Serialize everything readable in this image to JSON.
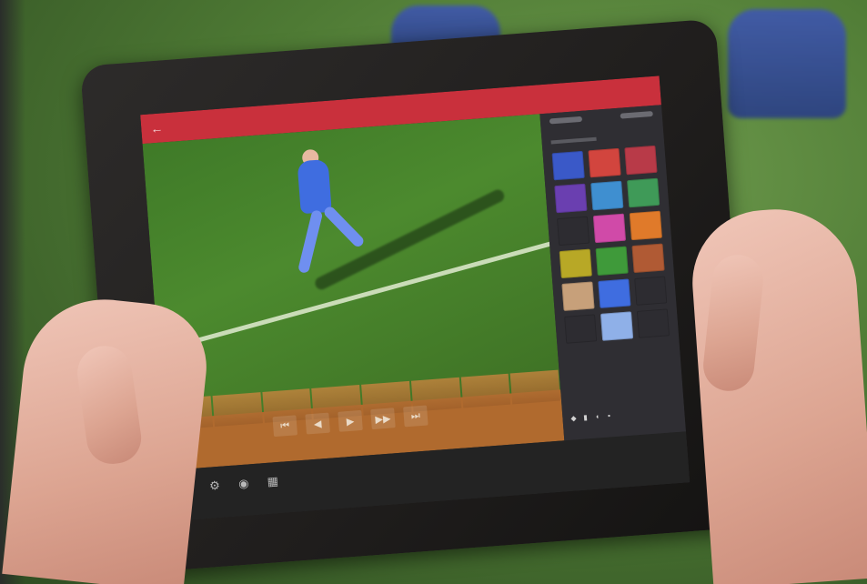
{
  "scene": {
    "background": "green football pitch with blurred players in blue kits",
    "colors": {
      "app_bar": "#c9303c",
      "panel": "#2f2e33",
      "pitch": "#4c8a2e",
      "timeline": "#b06a2e",
      "bezel": "#1f1d1c"
    }
  },
  "tablet": {
    "app_bar": {
      "back_icon": "back-arrow-icon",
      "title": ""
    },
    "video": {
      "content": "football player in blue kit running on pitch"
    },
    "timeline": {
      "controls": [
        {
          "name": "previous-icon",
          "glyph": "⏮"
        },
        {
          "name": "rewind-icon",
          "glyph": "◀"
        },
        {
          "name": "play-icon",
          "glyph": "▶"
        },
        {
          "name": "forward-icon",
          "glyph": "▶▶"
        },
        {
          "name": "next-icon",
          "glyph": "⏭"
        }
      ]
    },
    "bottom_tools": [
      {
        "name": "draw-icon",
        "glyph": "✎"
      },
      {
        "name": "gear-icon",
        "glyph": "⚙"
      },
      {
        "name": "camera-icon",
        "glyph": "◉"
      },
      {
        "name": "grid-icon",
        "glyph": "▦"
      }
    ],
    "side_panel": {
      "tiles": [
        "#3a59c8",
        "#d2453e",
        "#b83a48",
        "#6a3fb0",
        "#3f8fd0",
        "#3f9a58",
        "#2d2c31",
        "#d04aa8",
        "#e07a2a",
        "#b8a826",
        "#3f9a3a",
        "#b05a34",
        "#c7a07a",
        "#3f6de0",
        "#2d2c31",
        "#2d2c31",
        "#8fb0e8",
        "#2d2c31"
      ]
    },
    "tray": [
      {
        "name": "wifi-icon",
        "glyph": "◆"
      },
      {
        "name": "battery-icon",
        "glyph": "▮"
      },
      {
        "name": "sound-icon",
        "glyph": "◖"
      },
      {
        "name": "notification-icon",
        "glyph": "▪"
      }
    ]
  }
}
